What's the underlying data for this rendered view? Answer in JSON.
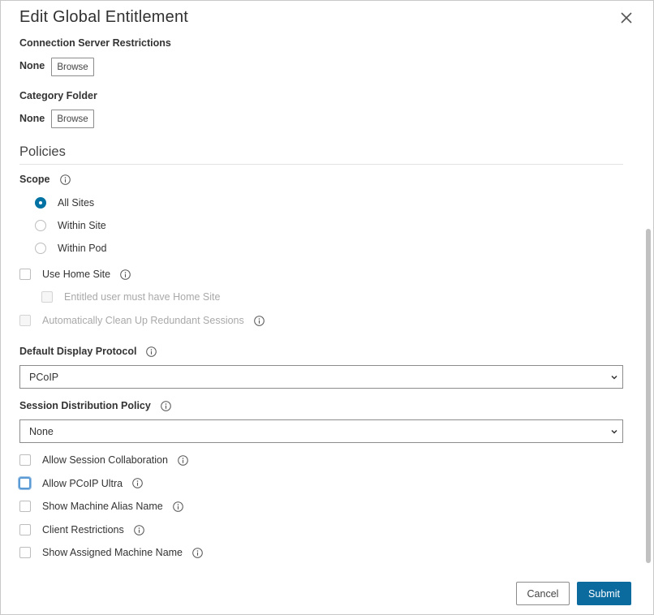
{
  "dialog": {
    "title": "Edit Global Entitlement",
    "close_icon": "close-icon"
  },
  "connection_server": {
    "label": "Connection Server Restrictions",
    "value": "None",
    "browse_label": "Browse"
  },
  "category_folder": {
    "label": "Category Folder",
    "value": "None",
    "browse_label": "Browse"
  },
  "policies": {
    "heading": "Policies",
    "scope": {
      "label": "Scope",
      "options": [
        {
          "label": "All Sites",
          "checked": true
        },
        {
          "label": "Within Site",
          "checked": false
        },
        {
          "label": "Within Pod",
          "checked": false
        }
      ]
    },
    "use_home_site": {
      "label": "Use Home Site",
      "checked": false
    },
    "entitled_user_home_site": {
      "label": "Entitled user must have Home Site",
      "checked": false,
      "disabled": true
    },
    "auto_cleanup": {
      "label": "Automatically Clean Up Redundant Sessions",
      "checked": false,
      "disabled": true
    },
    "default_display_protocol": {
      "label": "Default Display Protocol",
      "selected": "PCoIP"
    },
    "session_distribution_policy": {
      "label": "Session Distribution Policy",
      "selected": "None"
    },
    "options": [
      {
        "label": "Allow Session Collaboration",
        "checked": false
      },
      {
        "label": "Allow PCoIP Ultra",
        "checked": false,
        "focused": true
      },
      {
        "label": "Show Machine Alias Name",
        "checked": false
      },
      {
        "label": "Client Restrictions",
        "checked": false
      },
      {
        "label": "Show Assigned Machine Name",
        "checked": false
      }
    ]
  },
  "footer": {
    "cancel_label": "Cancel",
    "submit_label": "Submit"
  },
  "colors": {
    "accent": "#0072a3",
    "submit_bg": "#0b6b9f",
    "focus_ring": "#5b9bd5",
    "disabled_text": "#a9a9a9"
  }
}
